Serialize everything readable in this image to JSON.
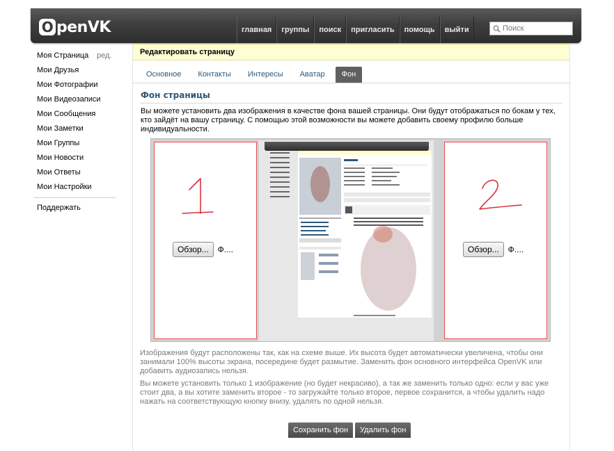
{
  "app": {
    "logo_text": "penVK",
    "logo_letter": "O"
  },
  "nav": {
    "items": [
      "главная",
      "группы",
      "поиск",
      "пригласить",
      "помощь",
      "выйти"
    ],
    "search_placeholder": "Поиск"
  },
  "sidebar": {
    "items": [
      "Моя Страница",
      "Мои Друзья",
      "Мои Фотографии",
      "Мои Видеозаписи",
      "Мои Сообщения",
      "Мои Заметки",
      "Мои Группы",
      "Мои Новости",
      "Мои Ответы",
      "Мои Настройки"
    ],
    "edit_label": "ред.",
    "support_label": "Поддержать"
  },
  "page": {
    "title": "Редактировать страницу",
    "tabs": [
      "Основное",
      "Контакты",
      "Интересы",
      "Аватар",
      "Фон"
    ],
    "active_tab_index": 4,
    "section_title": "Фон страницы",
    "description": "Вы можете установить два изображения в качестве фона вашей страницы. Они будут отображаться по бокам у тех, кто зайдёт на вашу страницу. С помощью этой возможности вы можете добавить своему профилю больше индивидуальности.",
    "note1": "Изображения будут расположены так, как на схеме выше. Их высота будет автоматически увеличена, чтобы они занимали 100% высоты экрана, посередине будет размытие. Заменить фон основного интерфейса OpenVK или добавить аудиозапись нельзя.",
    "note2": "Вы можете установить только 1 изображение (но будет некрасиво), а так же заменить только одно: если у вас уже стоит два, а вы хотите заменить второе - то загружайте только второе, первое сохранится, а чтобы удалить надо нажать на соответствующую кнопку внизу, удалять по одной нельзя.",
    "save_button": "Сохранить фон",
    "delete_button": "Удалить фон"
  },
  "preview": {
    "left_digit": "1",
    "right_digit": "2",
    "browse_label": "Обзор...",
    "file_label": "Ф....",
    "digit_color": "#d8303a"
  },
  "colors": {
    "link": "#2b587a",
    "header_dark": "#3e3e3e",
    "title_bg": "#fefdd4",
    "panel_border": "#e05050"
  }
}
